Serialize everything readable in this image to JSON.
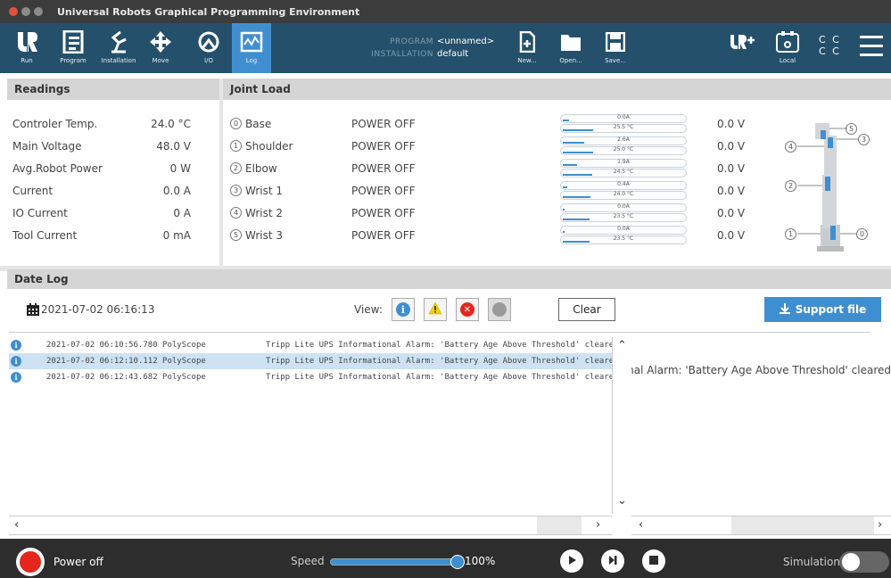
{
  "window": {
    "title": "Universal Robots Graphical Programming Environment"
  },
  "toolbar": {
    "items": [
      {
        "label": "Run",
        "icon": "ur-logo-icon"
      },
      {
        "label": "Program",
        "icon": "program-icon"
      },
      {
        "label": "Installation",
        "icon": "installation-icon"
      },
      {
        "label": "Move",
        "icon": "move-icon"
      },
      {
        "label": "I/O",
        "icon": "io-icon"
      },
      {
        "label": "Log",
        "icon": "log-icon"
      }
    ],
    "program_key": "PROGRAM",
    "program_value": "<unnamed>",
    "installation_key": "INSTALLATION",
    "installation_value": "default",
    "file_actions": [
      {
        "label": "New...",
        "icon": "new-file-icon"
      },
      {
        "label": "Open...",
        "icon": "open-folder-icon"
      },
      {
        "label": "Save...",
        "icon": "save-icon"
      }
    ],
    "local_label": "Local",
    "cc_text": "C C"
  },
  "readings": {
    "title": "Readings",
    "rows": [
      {
        "name": "Controler Temp.",
        "value": "24.0 °C"
      },
      {
        "name": "Main Voltage",
        "value": "48.0 V"
      },
      {
        "name": "Avg.Robot Power",
        "value": "0 W"
      },
      {
        "name": "Current",
        "value": "0.0 A"
      },
      {
        "name": "IO Current",
        "value": "0 A"
      },
      {
        "name": "Tool Current",
        "value": "0 mA"
      }
    ]
  },
  "joint_load": {
    "title": "Joint Load",
    "joints": [
      {
        "num": "0",
        "name": "Base",
        "state": "POWER OFF",
        "current": "0.0A",
        "temp": "25.5 °C",
        "current_level": 0.05,
        "temp_level": 0.25,
        "voltage": "0.0 V"
      },
      {
        "num": "1",
        "name": "Shoulder",
        "state": "POWER OFF",
        "current": "2.6A",
        "temp": "25.0 °C",
        "current_level": 0.18,
        "temp_level": 0.25,
        "voltage": "0.0 V"
      },
      {
        "num": "2",
        "name": "Elbow",
        "state": "POWER OFF",
        "current": "1.9A",
        "temp": "24.5 °C",
        "current_level": 0.12,
        "temp_level": 0.24,
        "voltage": "0.0 V"
      },
      {
        "num": "3",
        "name": "Wrist 1",
        "state": "POWER OFF",
        "current": "0.4A",
        "temp": "24.0 °C",
        "current_level": 0.04,
        "temp_level": 0.23,
        "voltage": "0.0 V"
      },
      {
        "num": "4",
        "name": "Wrist 2",
        "state": "POWER OFF",
        "current": "0.0A",
        "temp": "23.5 °C",
        "current_level": 0.0,
        "temp_level": 0.22,
        "voltage": "0.0 V"
      },
      {
        "num": "5",
        "name": "Wrist 3",
        "state": "POWER OFF",
        "current": "0.0A",
        "temp": "23.5 °C",
        "current_level": 0.0,
        "temp_level": 0.22,
        "voltage": "0.0 V"
      }
    ],
    "diagram_labels": [
      "0",
      "1",
      "2",
      "3",
      "4",
      "5"
    ]
  },
  "date_log": {
    "title": "Date Log",
    "date": "2021-07-02 06:16:13",
    "view_label": "View:",
    "clear_label": "Clear",
    "support_label": "Support file",
    "entries": [
      {
        "timestamp": "2021-07-02 06:10:56.780 PolyScope",
        "message": "Tripp Lite UPS Informational Alarm: 'Battery Age Above Threshold' cleared",
        "selected": false
      },
      {
        "timestamp": "2021-07-02 06:12:10.112 PolyScope",
        "message": "Tripp Lite UPS Informational Alarm: 'Battery Age Above Threshold' cleared",
        "selected": true
      },
      {
        "timestamp": "2021-07-02 06:12:43.682 PolyScope",
        "message": "Tripp Lite UPS Informational Alarm: 'Battery Age Above Threshold' cleared",
        "selected": false
      }
    ],
    "detail_text": "Tripp Lite UPS Informational Alarm: 'Battery Age Above Threshold' cleared"
  },
  "bottom": {
    "power_label": "Power off",
    "speed_label": "Speed",
    "speed_value": "100%",
    "speed_level": 1.0,
    "simulation_label": "Simulation",
    "simulation_on": false
  },
  "colors": {
    "toolbar_bg": "#25506b",
    "accent": "#3f8fd0",
    "power_red": "#e5261e",
    "warning_yellow": "#f5d000"
  }
}
